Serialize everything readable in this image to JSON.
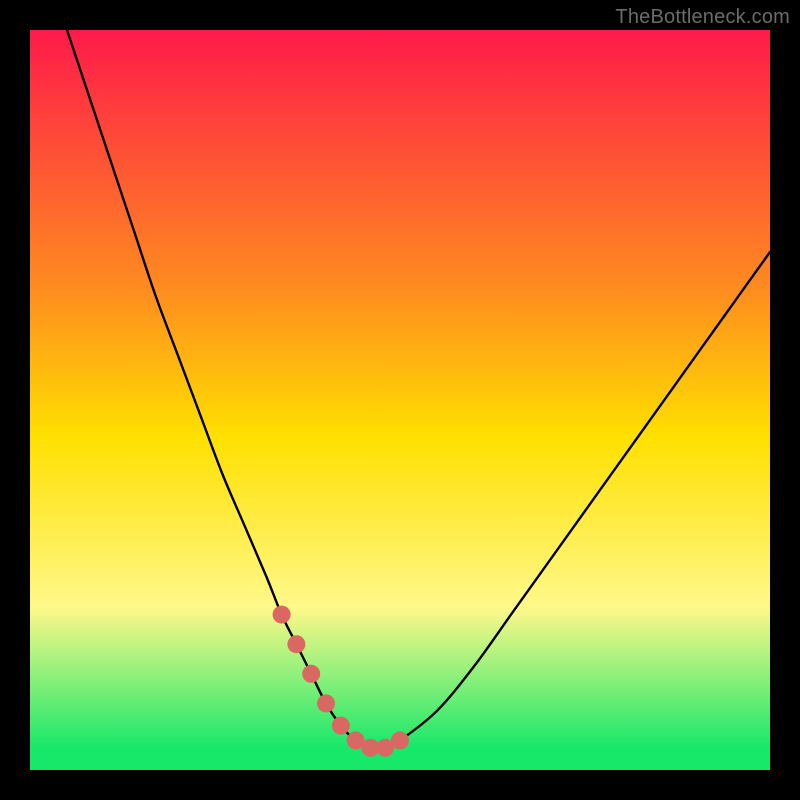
{
  "watermark": {
    "text": "TheBottleneck.com"
  },
  "colors": {
    "black": "#000000",
    "curve": "#000000",
    "marker": "#d96862",
    "green": "#17e86a",
    "yellow": "#ffec00",
    "red_top": "#ff1a4a",
    "orange_mid": "#ffa200"
  },
  "chart_data": {
    "type": "line",
    "title": "",
    "xlabel": "",
    "ylabel": "",
    "xlim": [
      0,
      100
    ],
    "ylim": [
      0,
      100
    ],
    "grid": false,
    "series": [
      {
        "name": "bottleneck-curve",
        "x": [
          5,
          8,
          11,
          14,
          17,
          20,
          23,
          26,
          29,
          32,
          34,
          36,
          38,
          40,
          42,
          44,
          46,
          48,
          50,
          55,
          60,
          65,
          70,
          75,
          80,
          85,
          90,
          95,
          100
        ],
        "values": [
          100,
          91,
          82,
          73,
          64,
          56,
          48,
          40,
          33,
          26,
          21,
          17,
          13,
          9,
          6,
          4,
          3,
          3,
          4,
          8,
          14,
          21,
          28,
          35,
          42,
          49,
          56,
          63,
          70
        ],
        "note": "y = bottleneck percentage (100=severe, 0=none). Curve descends steeply from top-left, bottoms out near x≈44–48, then rises roughly linearly toward the right edge reaching about 70% at x=100."
      }
    ],
    "markers": {
      "name": "highlighted-range",
      "x": [
        34,
        36,
        38,
        40,
        42,
        44,
        46,
        48,
        50
      ],
      "values": [
        21,
        17,
        13,
        9,
        6,
        4,
        3,
        3,
        4
      ],
      "note": "Reddish dots along the bottom of the valley marking the optimal low-bottleneck zone."
    },
    "background_gradient": {
      "orientation": "vertical",
      "stops": [
        {
          "pos": 0.0,
          "color": "#ff1a4a"
        },
        {
          "pos": 0.35,
          "color": "#ff8c1f"
        },
        {
          "pos": 0.55,
          "color": "#ffe000"
        },
        {
          "pos": 0.78,
          "color": "#fff88a"
        },
        {
          "pos": 0.97,
          "color": "#17e86a"
        },
        {
          "pos": 1.0,
          "color": "#17e86a"
        }
      ],
      "note": "Vertical rainbow gradient: red at top through orange/yellow to a thin green band at the very bottom."
    }
  }
}
